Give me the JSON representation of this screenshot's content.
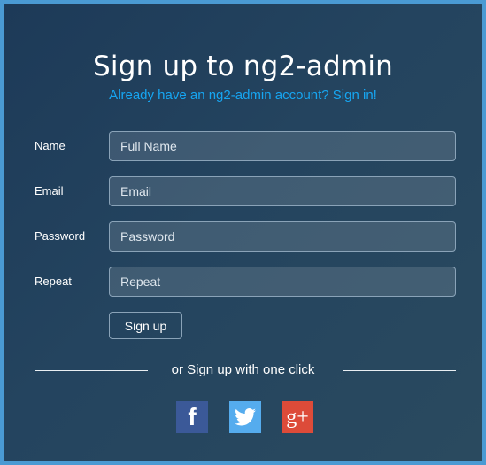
{
  "title": "Sign up to ng2-admin",
  "signin_link": "Already have an ng2-admin account? Sign in!",
  "form": {
    "name": {
      "label": "Name",
      "placeholder": "Full Name"
    },
    "email": {
      "label": "Email",
      "placeholder": "Email"
    },
    "password": {
      "label": "Password",
      "placeholder": "Password"
    },
    "repeat": {
      "label": "Repeat",
      "placeholder": "Repeat"
    },
    "submit_label": "Sign up"
  },
  "divider_text": "or Sign up with one click",
  "social": {
    "facebook": {
      "icon": "facebook-icon",
      "glyph": "f",
      "color": "#3b5998"
    },
    "twitter": {
      "icon": "twitter-icon",
      "color": "#55acee"
    },
    "google_plus": {
      "icon": "google-plus-icon",
      "glyph": "g+",
      "color": "#dd4b39"
    }
  },
  "colors": {
    "accent": "#16a6f2",
    "background": "#1d3a58"
  }
}
